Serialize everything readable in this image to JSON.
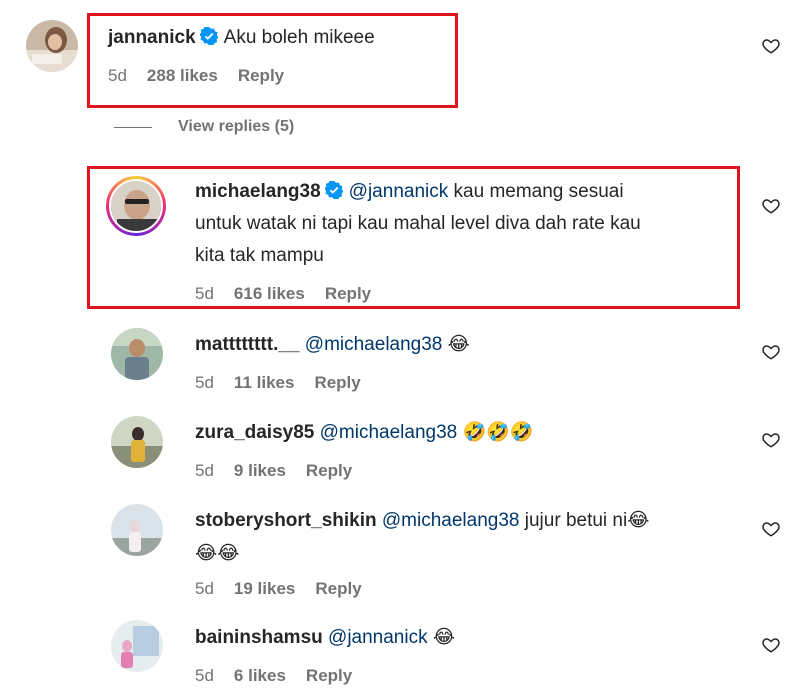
{
  "comments": [
    {
      "username": "jannanick",
      "verified": true,
      "mention": "",
      "text": "Aku boleh mikeee",
      "age": "5d",
      "likes": "288 likes",
      "reply": "Reply"
    },
    {
      "username": "michaelang38",
      "verified": true,
      "mention": "@jannanick",
      "text_line1": "kau memang sesuai",
      "text_line2": "untuk watak ni tapi kau mahal level diva dah rate kau",
      "text_line3": "kita tak mampu",
      "age": "5d",
      "likes": "616 likes",
      "reply": "Reply"
    },
    {
      "username": "matttttttt.__",
      "mention": "@michaelang38",
      "emoji": "😂",
      "age": "5d",
      "likes": "11 likes",
      "reply": "Reply"
    },
    {
      "username": "zura_daisy85",
      "mention": "@michaelang38",
      "emoji": "🤣🤣🤣",
      "age": "5d",
      "likes": "9 likes",
      "reply": "Reply"
    },
    {
      "username": "stoberyshort_shikin",
      "mention": "@michaelang38",
      "text": "jujur betui ni",
      "emoji_inline": "😂",
      "emoji_line2": "😂😂",
      "age": "5d",
      "likes": "19 likes",
      "reply": "Reply"
    },
    {
      "username": "baininshamsu",
      "mention": "@jannanick",
      "emoji": "😂",
      "age": "5d",
      "likes": "6 likes",
      "reply": "Reply"
    }
  ],
  "view_replies": "View replies (5)",
  "colors": {
    "highlight_box": "#e0141e",
    "mention": "#00376b",
    "verified": "#0095f6",
    "meta": "#737373"
  },
  "icons": {
    "like": "heart-outline-icon",
    "verified": "verified-badge-icon"
  }
}
